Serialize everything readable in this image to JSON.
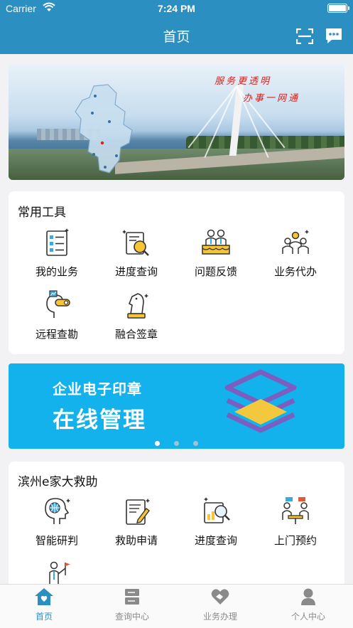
{
  "status_bar": {
    "carrier": "Carrier",
    "time": "7:24 PM"
  },
  "nav": {
    "title": "首页",
    "icons": [
      "scan-icon",
      "message-icon"
    ]
  },
  "banner": {
    "slogan_line1": "服务更透明",
    "slogan_line2": "办事一网通"
  },
  "common_tools": {
    "title": "常用工具",
    "items": [
      {
        "label": "我的业务",
        "icon": "checklist-icon"
      },
      {
        "label": "进度查询",
        "icon": "document-search-icon"
      },
      {
        "label": "问题反馈",
        "icon": "meeting-icon"
      },
      {
        "label": "业务代办",
        "icon": "group-icon"
      },
      {
        "label": "远程查勘",
        "icon": "vr-headset-icon"
      },
      {
        "label": "融合签章",
        "icon": "chess-knight-icon"
      }
    ]
  },
  "promo": {
    "line1": "企业电子印章",
    "line2": "在线管理",
    "slides": 3,
    "active_slide": 1
  },
  "rescue": {
    "title": "滨州e家大救助",
    "items": [
      {
        "label": "智能研判",
        "icon": "ai-head-icon"
      },
      {
        "label": "救助申请",
        "icon": "application-form-icon"
      },
      {
        "label": "进度查询",
        "icon": "report-magnifier-icon"
      },
      {
        "label": "上门预约",
        "icon": "appointment-icon"
      },
      {
        "label": "",
        "icon": "presenter-flag-icon"
      }
    ]
  },
  "tabbar": {
    "tabs": [
      {
        "label": "首页",
        "icon": "home-icon",
        "active": true
      },
      {
        "label": "查询中心",
        "icon": "server-icon",
        "active": false
      },
      {
        "label": "业务办理",
        "icon": "handshake-icon",
        "active": false
      },
      {
        "label": "个人中心",
        "icon": "person-icon",
        "active": false
      }
    ]
  },
  "colors": {
    "primary": "#2c8fc1",
    "promo_bg": "#14b2ec",
    "page_bg": "#f2f2f4"
  }
}
